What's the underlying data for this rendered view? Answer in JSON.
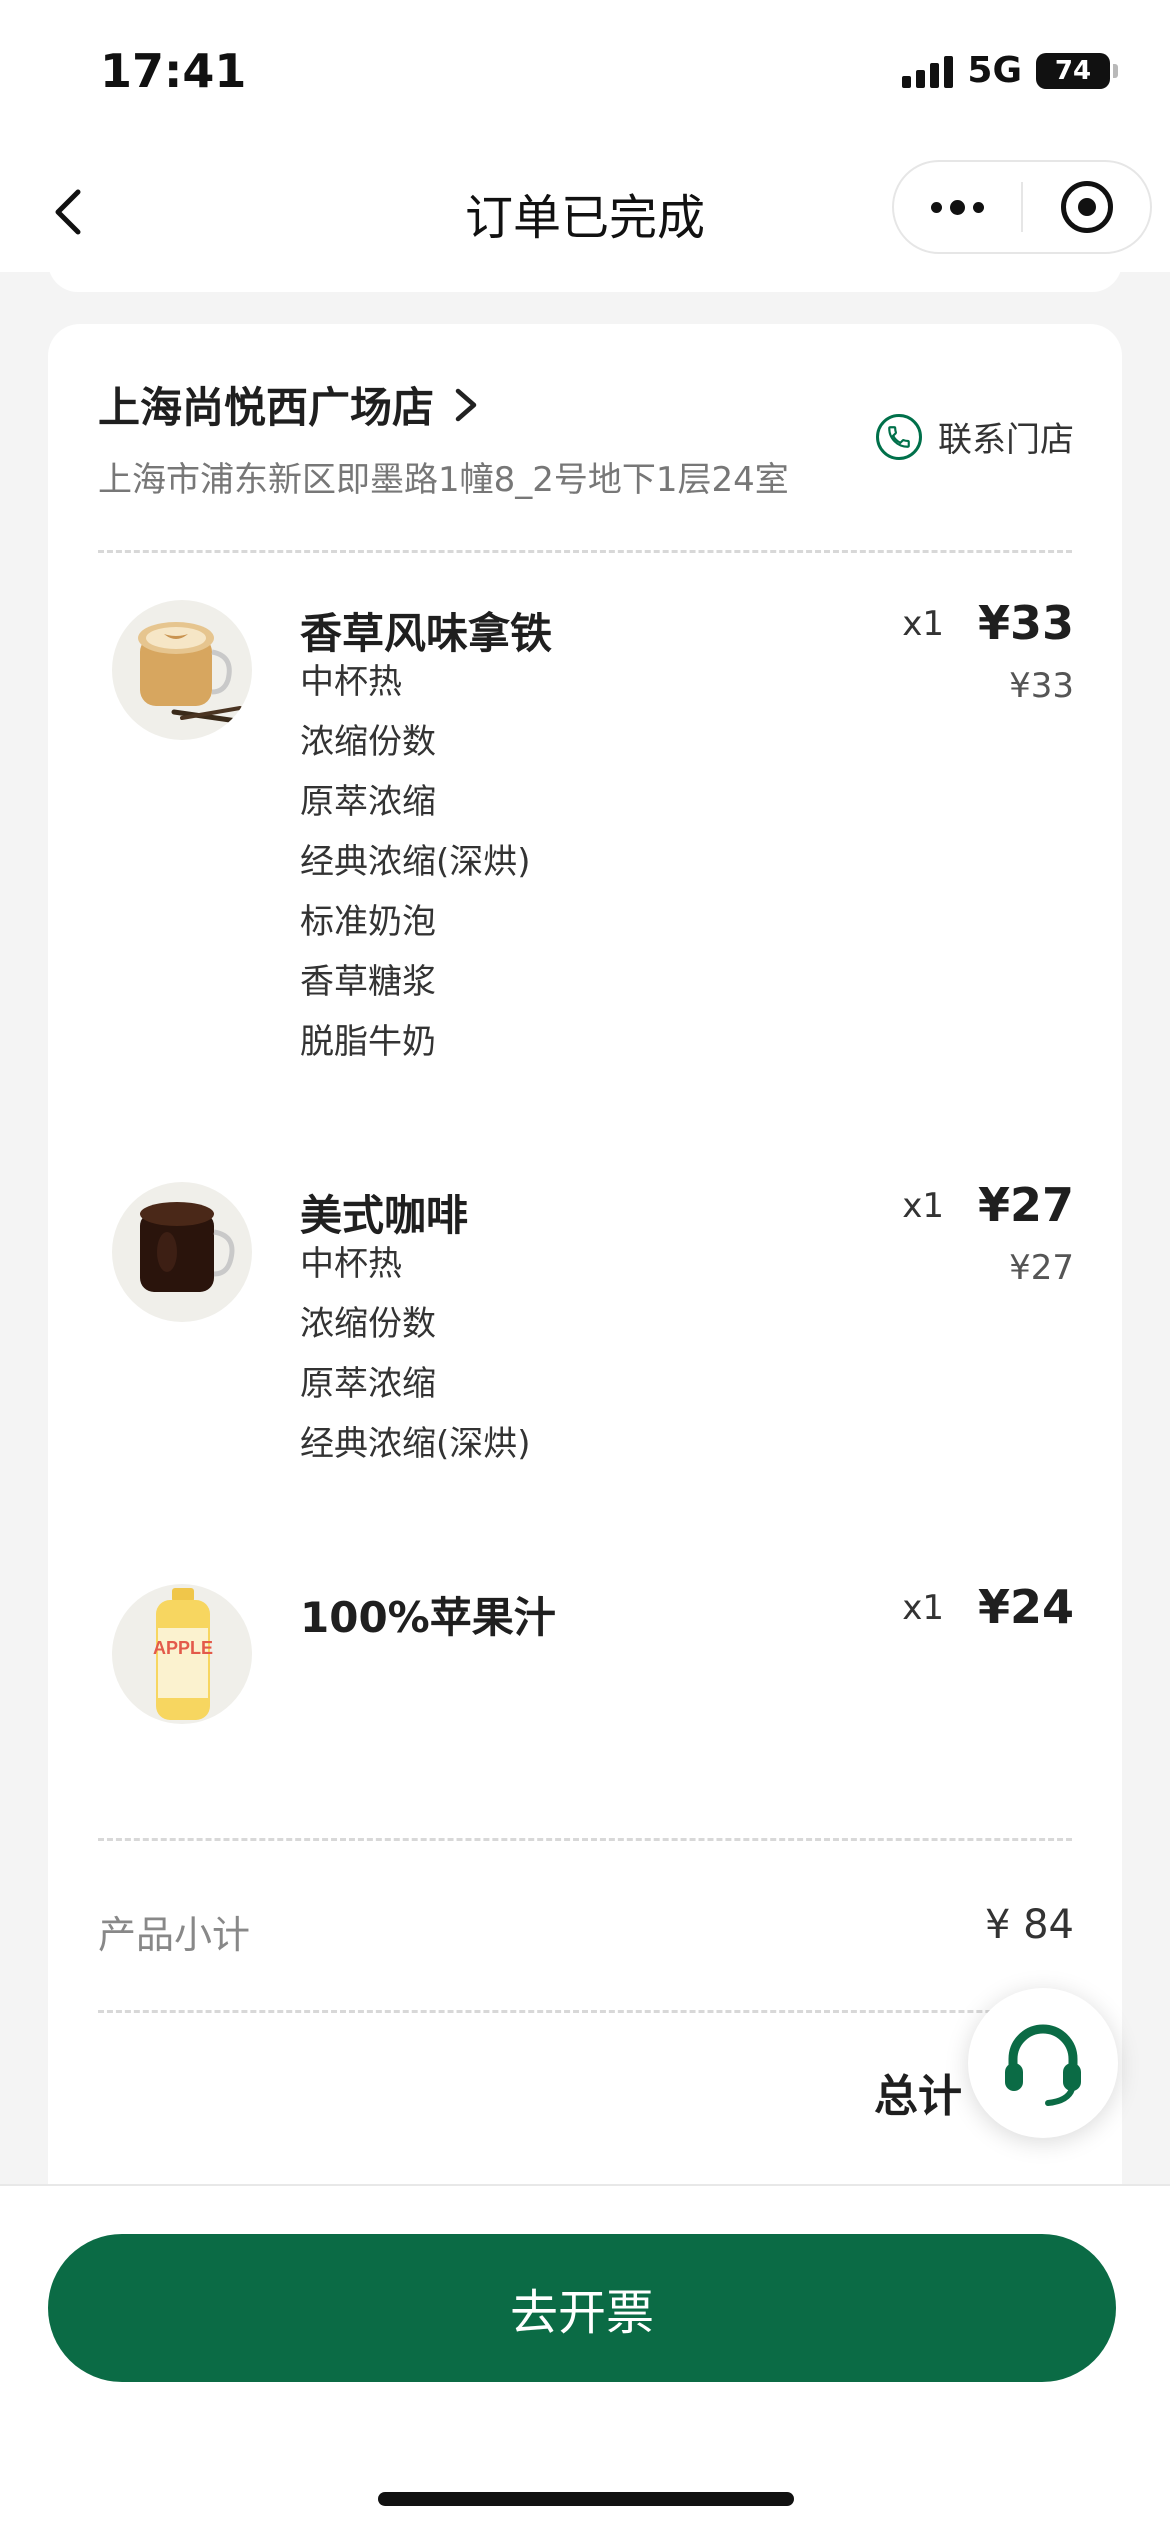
{
  "status_bar": {
    "time": "17:41",
    "network": "5G",
    "battery": "74"
  },
  "nav": {
    "title": "订单已完成"
  },
  "store": {
    "name": "上海尚悦西广场店",
    "address": "上海市浦东新区即墨路1幢8_2号地下1层24室",
    "contact_label": "联系门店"
  },
  "items": [
    {
      "name": "香草风味拿铁",
      "qty": "x1",
      "price": "¥33",
      "sub_price": "¥33",
      "specs": [
        "中杯热",
        "浓缩份数",
        "原萃浓缩",
        "经典浓缩(深烘)",
        "标准奶泡",
        "香草糖浆",
        "脱脂牛奶"
      ]
    },
    {
      "name": "美式咖啡",
      "qty": "x1",
      "price": "¥27",
      "sub_price": "¥27",
      "specs": [
        "中杯热",
        "浓缩份数",
        "原萃浓缩",
        "经典浓缩(深烘)"
      ]
    },
    {
      "name": "100%苹果汁",
      "qty": "x1",
      "price": "¥24",
      "bottle_text": "APPLE"
    }
  ],
  "summary": {
    "subtotal_label": "产品小计",
    "subtotal_value": "¥ 84",
    "total_label": "总计"
  },
  "bottom": {
    "invoice_button": "去开票"
  },
  "colors": {
    "brand_green": "#0b6b45",
    "phone_green": "#00704a"
  },
  "icons": [
    "back-chevron-icon",
    "more-dots-icon",
    "target-icon",
    "chevron-right-icon",
    "phone-icon",
    "headset-icon"
  ]
}
